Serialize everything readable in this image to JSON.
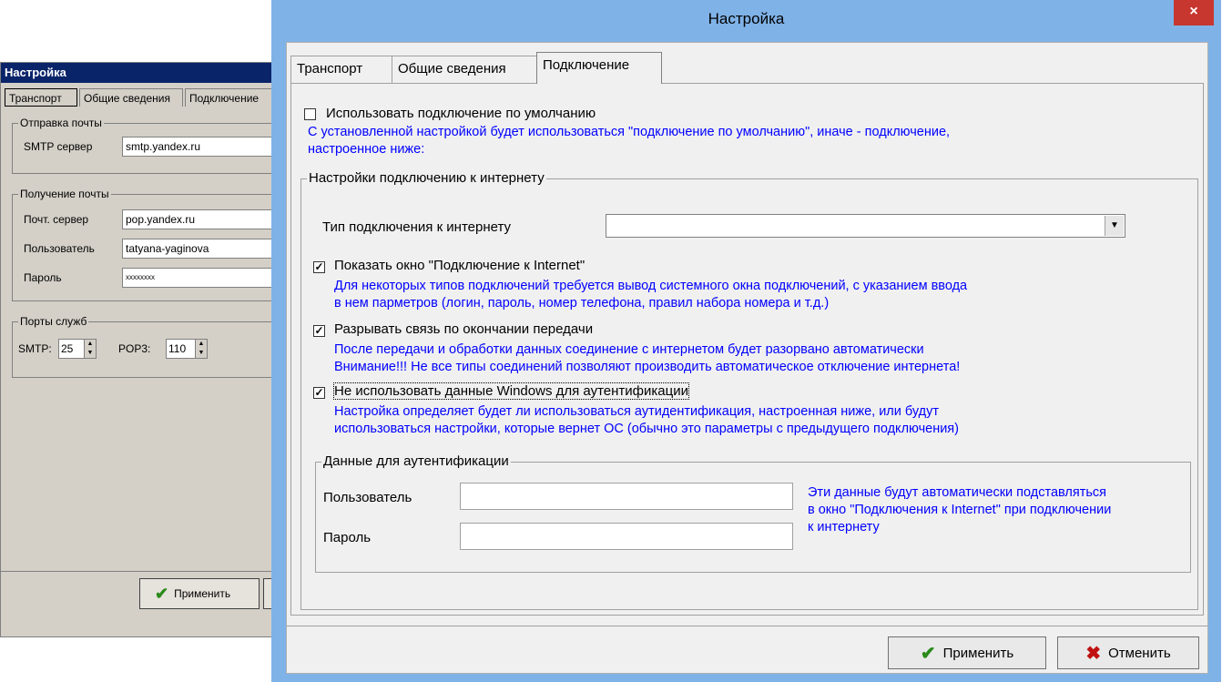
{
  "back_window": {
    "title": "Настройка",
    "tabs": [
      "Транспорт",
      "Общие сведения",
      "Подключение"
    ],
    "send_group": {
      "title": "Отправка почты",
      "smtp_label": "SMTP сервер",
      "smtp_value": "smtp.yandex.ru"
    },
    "receive_group": {
      "title": "Получение почты",
      "server_label": "Почт. сервер",
      "server_value": "pop.yandex.ru",
      "user_label": "Пользователь",
      "user_value": "tatyana-yaginova",
      "password_label": "Пароль",
      "password_value": "xxxxxxxx"
    },
    "ports_group": {
      "title": "Порты служб",
      "smtp_label": "SMTP:",
      "smtp_value": "25",
      "pop3_label": "POP3:",
      "pop3_value": "110"
    },
    "apply_label": "Применить"
  },
  "main_window": {
    "title": "Настройка",
    "close_glyph": "×",
    "tabs": [
      "Транспорт",
      "Общие сведения",
      "Подключение"
    ],
    "active_tab": "Подключение",
    "use_default": {
      "checked": false,
      "label": "Использовать подключение по умолчанию",
      "hint_line1": "С установленной настройкой будет использоваться \"подключение по умолчанию\", иначе - подключение,",
      "hint_line2": "настроенное ниже:"
    },
    "internet_group": {
      "title": "Настройки подключению к интернету",
      "conn_type_label": "Тип подключения к интернету",
      "conn_type_value": "",
      "show_window": {
        "checked": true,
        "label": "Показать окно \"Подключение к Internet\"",
        "hint_line1": "Для некоторых типов подключений требуется вывод системного окна подключений, с указанием ввода",
        "hint_line2": "в нем парметров (логин, пароль, номер телефона, правил набора номера и т.д.)"
      },
      "disconnect": {
        "checked": true,
        "label": "Разрывать связь по окончании передачи",
        "hint_line1": "После передачи и обработки данных соединение с интернетом будет разорвано автоматически",
        "hint_line2": "Внимание!!! Не все типы соединений позволяют производить автоматическое отключение интернета!"
      },
      "no_windows_auth": {
        "checked": true,
        "label": "Не использовать данные Windows для аутентификации",
        "hint_line1": "Настройка определяет будет ли использоваться аутидентификация, настроенная ниже, или будут",
        "hint_line2": " использоваться настройки, которые вернет ОС (обычно это параметры с предыдущего подключения)"
      },
      "auth_group": {
        "title": "Данные для аутентификации",
        "user_label": "Пользователь",
        "user_value": "",
        "password_label": "Пароль",
        "password_value": "",
        "hint_line1": "Эти данные будут автоматически подставляться",
        "hint_line2": "в окно \"Подключения к Internet\" при подключении",
        "hint_line3": "к интернету"
      }
    },
    "apply_label": "Применить",
    "cancel_label": "Отменить"
  },
  "colors": {
    "hint_text": "#0000ff",
    "title_bar": "#7fb2e7",
    "close_button": "#c7372f",
    "apply_check": "#2a8a1a",
    "cancel_cross": "#c01010"
  },
  "icons": {
    "apply": "checkmark-icon",
    "cancel": "cross-icon",
    "checkbox_checked": "check-mark"
  }
}
